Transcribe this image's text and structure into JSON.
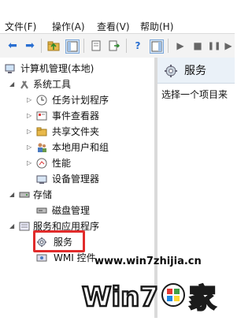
{
  "menubar": {
    "items": [
      "文件(F)",
      "操作(A)",
      "查看(V)",
      "帮助(H)"
    ]
  },
  "tree": {
    "root": "计算机管理(本地)",
    "system_tools": "系统工具",
    "task_scheduler": "任务计划程序",
    "event_viewer": "事件查看器",
    "shared_folders": "共享文件夹",
    "local_users": "本地用户和组",
    "performance": "性能",
    "device_manager": "设备管理器",
    "storage": "存储",
    "disk_mgmt": "磁盘管理",
    "services_apps": "服务和应用程序",
    "services": "服务",
    "wmi": "WMI 控件"
  },
  "right": {
    "title": "服务",
    "hint": "选择一个项目来"
  },
  "watermark": {
    "url": "www.win7zhijia.cn",
    "logo_text": "Win7之家"
  },
  "colors": {
    "highlight": "#e12b2b",
    "toolbar": "#f3f3f3",
    "right_header": "#eaf1f8"
  }
}
